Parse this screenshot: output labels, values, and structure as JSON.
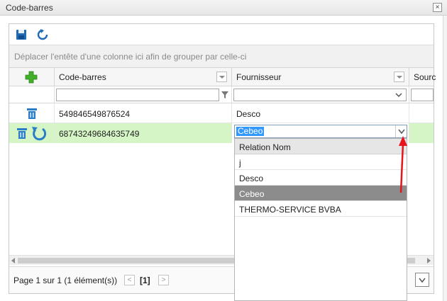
{
  "window": {
    "title": "Code-barres",
    "close_label": "×"
  },
  "toolbar": {
    "save_icon": "save-icon",
    "refresh_icon": "refresh-icon"
  },
  "group_hint": "Déplacer l'entête d'une colonne ici afin de grouper par celle-ci",
  "columns": [
    "Code-barres",
    "Fournisseur",
    "Sourc"
  ],
  "filters": {
    "barcode_value": "",
    "supplier_value": ""
  },
  "rows": [
    {
      "barcode": "549846549876524",
      "supplier": "Desco"
    },
    {
      "barcode": "68743249684635749",
      "supplier": "Cebeo",
      "editing": true
    }
  ],
  "dropdown": {
    "header": "Relation Nom",
    "items": [
      "j",
      "Desco",
      "Cebeo",
      "THERMO-SERVICE BVBA"
    ],
    "selected_index": 2
  },
  "pager": {
    "summary": "Page 1 sur 1 (1 élément(s))",
    "current_page": "[1]"
  },
  "colors": {
    "edit_row": "#d5f5c6",
    "accent_arrow": "#e8141c",
    "selected_item": "#8c8c8c"
  }
}
